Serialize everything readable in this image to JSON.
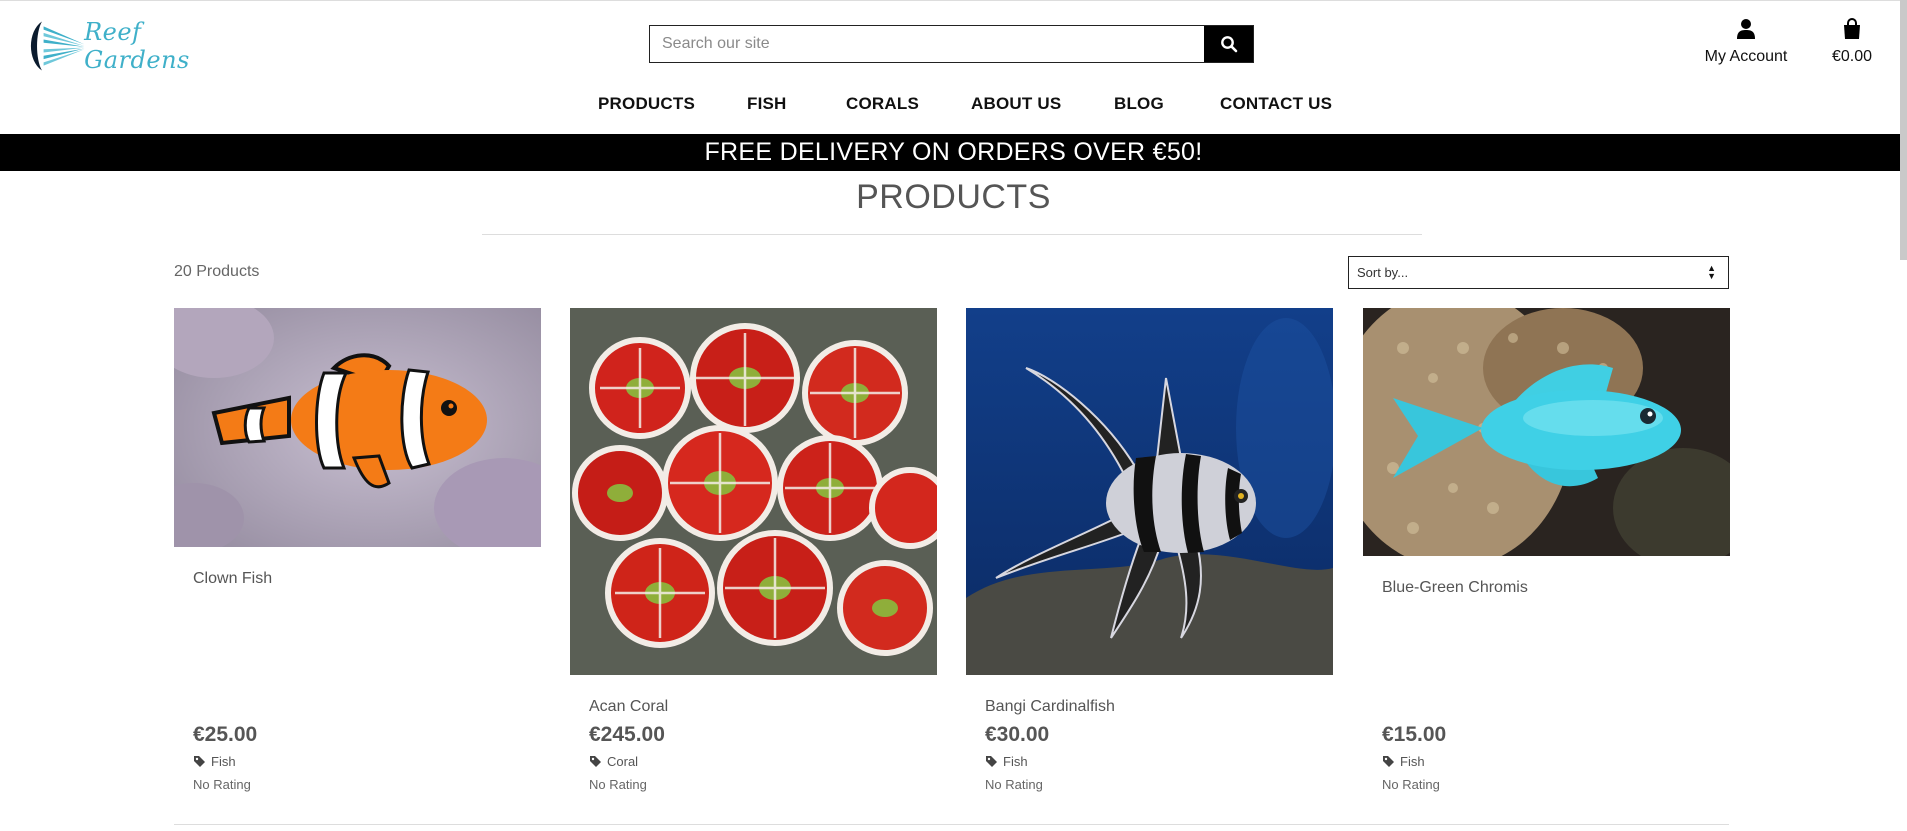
{
  "brand": {
    "name": "Reef Gardens",
    "accent": "#3fb0c9"
  },
  "search": {
    "placeholder": "Search our site",
    "value": ""
  },
  "header": {
    "account_label": "My Account",
    "cart_total": "€0.00"
  },
  "nav": {
    "items": [
      "PRODUCTS",
      "FISH",
      "CORALS",
      "ABOUT US",
      "BLOG",
      "CONTACT US"
    ]
  },
  "banner": {
    "text": "FREE DELIVERY ON ORDERS OVER €50!"
  },
  "page": {
    "title": "PRODUCTS",
    "count": "20 Products",
    "sort_selected": "Sort by..."
  },
  "products": [
    {
      "name": "Clown Fish",
      "price": "€25.00",
      "category": "Fish",
      "rating": "No Rating",
      "image": "clownfish"
    },
    {
      "name": "Acan Coral",
      "price": "€245.00",
      "category": "Coral",
      "rating": "No Rating",
      "image": "acan-coral"
    },
    {
      "name": "Bangi Cardinalfish",
      "price": "€30.00",
      "category": "Fish",
      "rating": "No Rating",
      "image": "cardinalfish"
    },
    {
      "name": "Blue-Green Chromis",
      "price": "€15.00",
      "category": "Fish",
      "rating": "No Rating",
      "image": "chromis"
    }
  ],
  "icons": [
    "search-icon",
    "user-icon",
    "shopping-bag-icon",
    "tag-icon",
    "sort-arrows-icon"
  ]
}
